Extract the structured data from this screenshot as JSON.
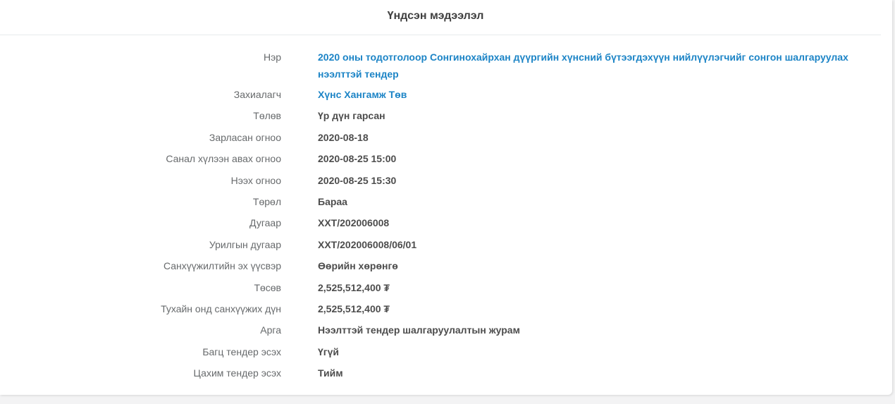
{
  "header": {
    "title": "Үндсэн мэдээлэл"
  },
  "fields": [
    {
      "label": "Нэр",
      "value": "2020 оны тодотголоор Сонгинохайрхан дүүргийн хүнсний бүтээгдэхүүн нийлүүлэгчийг сонгон шалгаруулах нээлттэй тендер"
    },
    {
      "label": "Захиалагч",
      "value": "Хүнс Хангамж Төв"
    },
    {
      "label": "Төлөв",
      "value": "Үр дүн гарсан"
    },
    {
      "label": "Зарласан огноо",
      "value": "2020-08-18"
    },
    {
      "label": "Санал хүлээн авах огноо",
      "value": "2020-08-25 15:00"
    },
    {
      "label": "Нээх огноо",
      "value": "2020-08-25 15:30"
    },
    {
      "label": "Төрөл",
      "value": "Бараа"
    },
    {
      "label": "Дугаар",
      "value": "ХХТ/202006008"
    },
    {
      "label": "Урилгын дугаар",
      "value": "ХХТ/202006008/06/01"
    },
    {
      "label": "Санхүүжилтийн эх үүсвэр",
      "value": "Өөрийн хөрөнгө"
    },
    {
      "label": "Төсөв",
      "value": "2,525,512,400 ₮"
    },
    {
      "label": "Тухайн онд санхүүжих дүн",
      "value": "2,525,512,400 ₮"
    },
    {
      "label": "Арга",
      "value": "Нээлттэй тендер шалгаруулалтын журам"
    },
    {
      "label": "Багц тендер эсэх",
      "value": "Үгүй"
    },
    {
      "label": "Цахим тендер эсэх",
      "value": "Тийм"
    }
  ],
  "colors": {
    "link": "#1c84c6",
    "label": "#676a6c",
    "value": "#4d4d4d"
  }
}
